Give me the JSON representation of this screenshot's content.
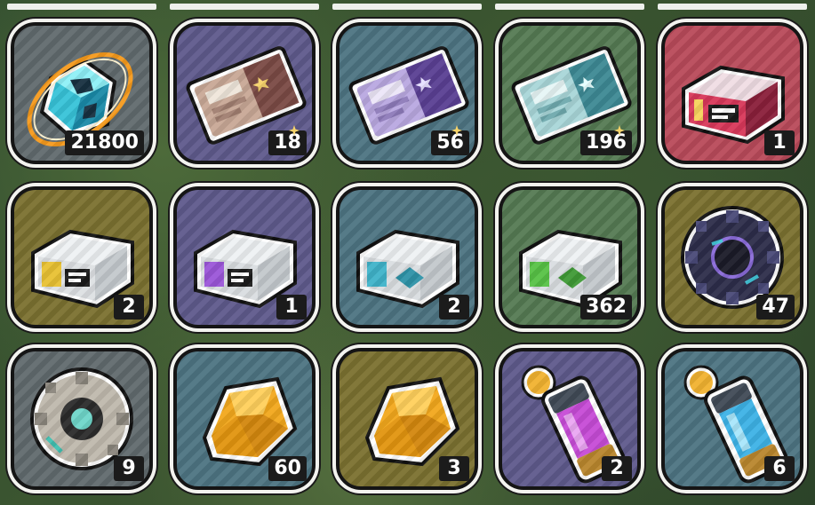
{
  "palette": {
    "grey": "#616a6e",
    "purple": "#5f5a8c",
    "teal": "#4d7482",
    "green": "#557a53",
    "red": "#b94a5a",
    "olive": "#7b7130",
    "orange_ring": "#f59a1c"
  },
  "inventory": {
    "items": [
      {
        "name": "blue-cube-crystal-icon",
        "count": "21800",
        "bg": "#616a6e"
      },
      {
        "name": "brown-ticket-icon",
        "count": "18",
        "bg": "#5f5a8c"
      },
      {
        "name": "purple-ticket-icon",
        "count": "56",
        "bg": "#4d7482"
      },
      {
        "name": "teal-ticket-icon",
        "count": "196",
        "bg": "#557a53"
      },
      {
        "name": "red-supply-box-icon",
        "count": "1",
        "bg": "#b94a5a"
      },
      {
        "name": "yellow-supply-box-icon",
        "count": "2",
        "bg": "#7b7130"
      },
      {
        "name": "purple-supply-box-icon",
        "count": "1",
        "bg": "#5f5a8c"
      },
      {
        "name": "teal-supply-box-icon",
        "count": "2",
        "bg": "#4d7482"
      },
      {
        "name": "green-supply-box-icon",
        "count": "362",
        "bg": "#557a53"
      },
      {
        "name": "dark-gear-chip-icon",
        "count": "47",
        "bg": "#7b7130"
      },
      {
        "name": "silver-gear-chip-icon",
        "count": "9",
        "bg": "#616a6e"
      },
      {
        "name": "amber-crystal-icon",
        "count": "60",
        "bg": "#4d7482"
      },
      {
        "name": "amber-crystal-icon",
        "count": "3",
        "bg": "#7b7130"
      },
      {
        "name": "purple-capsule-icon",
        "count": "2",
        "bg": "#5f5a8c"
      },
      {
        "name": "blue-capsule-icon",
        "count": "6",
        "bg": "#4d7482"
      }
    ]
  }
}
